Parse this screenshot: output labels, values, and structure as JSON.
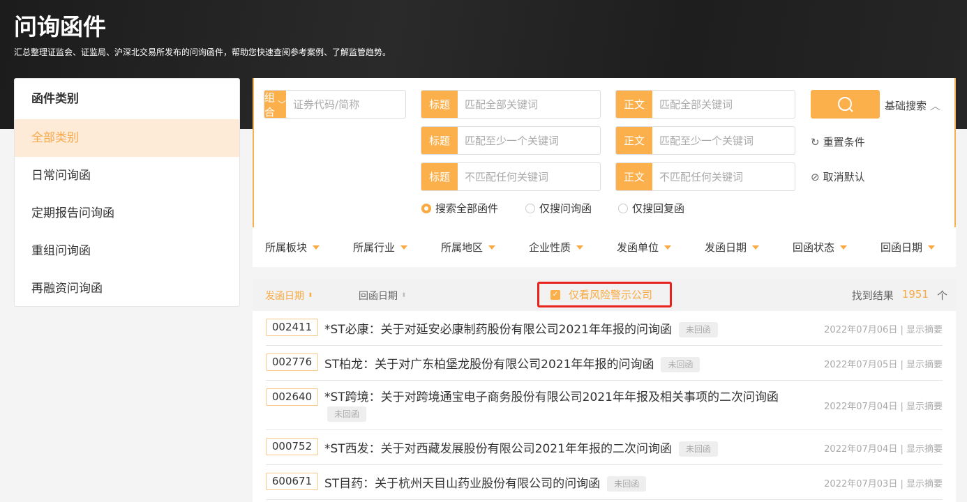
{
  "header": {
    "title": "问询函件",
    "subtitle": "汇总整理证监会、证监局、沪深北交易所发布的问询函件，帮助您快速查阅参考案例、了解监管趋势。"
  },
  "sidebar": {
    "title": "函件类别",
    "items": [
      "全部类别",
      "日常问询函",
      "定期报告问询函",
      "重组问询函",
      "再融资问询函"
    ]
  },
  "search": {
    "combo_label": "组合",
    "code_placeholder": "证券代码/简称",
    "title_label": "标题",
    "body_label": "正文",
    "placeholders": [
      "匹配全部关键词",
      "匹配至少一个关键词",
      "不匹配任何关键词"
    ],
    "basic_search": "基础搜索",
    "reset": "重置条件",
    "cancel_default": "取消默认",
    "scope": [
      "搜索全部函件",
      "仅搜问询函",
      "仅搜回复函"
    ]
  },
  "filters": [
    "所属板块",
    "所属行业",
    "所属地区",
    "企业性质",
    "发函单位",
    "发函日期",
    "回函状态",
    "回函日期"
  ],
  "results_header": {
    "sort_send": "发函日期",
    "sort_reply": "回函日期",
    "risk_only": "仅看风险警示公司",
    "found_label": "找到结果",
    "count": "1951",
    "unit": "个"
  },
  "rows": [
    {
      "code": "002411",
      "title": "*ST必康：关于对延安必康制药股份有限公司2021年年报的问询函",
      "status": "未回函",
      "date": "2022年07月06日",
      "action": "显示摘要"
    },
    {
      "code": "002776",
      "title": "ST柏龙：关于对广东柏堡龙股份有限公司2021年年报的问询函",
      "status": "未回函",
      "date": "2022年07月05日",
      "action": "显示摘要"
    },
    {
      "code": "002640",
      "title": "*ST跨境：关于对跨境通宝电子商务股份有限公司2021年年报及相关事项的二次问询函",
      "status": "未回函",
      "date": "2022年07月04日",
      "action": "显示摘要"
    },
    {
      "code": "000752",
      "title": "*ST西发：关于对西藏发展股份有限公司2021年年报的二次问询函",
      "status": "未回函",
      "date": "2022年07月04日",
      "action": "显示摘要"
    },
    {
      "code": "600671",
      "title": "ST目药：关于杭州天目山药业股份有限公司的问询函",
      "status": "未回函",
      "date": "2022年07月03日",
      "action": "显示摘要"
    }
  ],
  "colors": {
    "accent": "#fbb04c",
    "highlight": "#e8231e"
  }
}
